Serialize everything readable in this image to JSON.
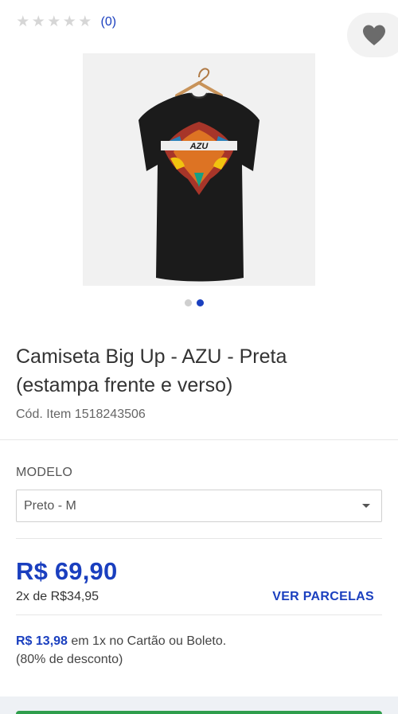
{
  "rating": {
    "stars": [
      "★",
      "★",
      "★",
      "★",
      "★"
    ],
    "stars_filled": 0,
    "count_label": "(0)",
    "star_color": "#d6d6d6",
    "count_color": "#1a3fbf"
  },
  "favorite": {
    "icon": "heart-icon",
    "color": "#6b6b6b"
  },
  "product": {
    "image_alt": "Camiseta preta com estampa AZU nas costas",
    "title": "Camiseta Big Up - AZU - Preta (estampa frente e verso)",
    "item_code": "Cód. Item 1518243506"
  },
  "carousel": {
    "count": 2,
    "active_index": 1
  },
  "modelo": {
    "label": "MODELO",
    "selected": "Preto - M"
  },
  "pricing": {
    "price": "R$ 69,90",
    "installments": "2x de R$34,95",
    "ver_parcelas": "VER PARCELAS",
    "discount_price": "R$ 13,98",
    "discount_text": " em 1x no Cartão ou Boleto.",
    "discount_note": "(80% de desconto)"
  },
  "colors": {
    "accent": "#1a3fbf",
    "buy_button": "#2e9e4c"
  }
}
